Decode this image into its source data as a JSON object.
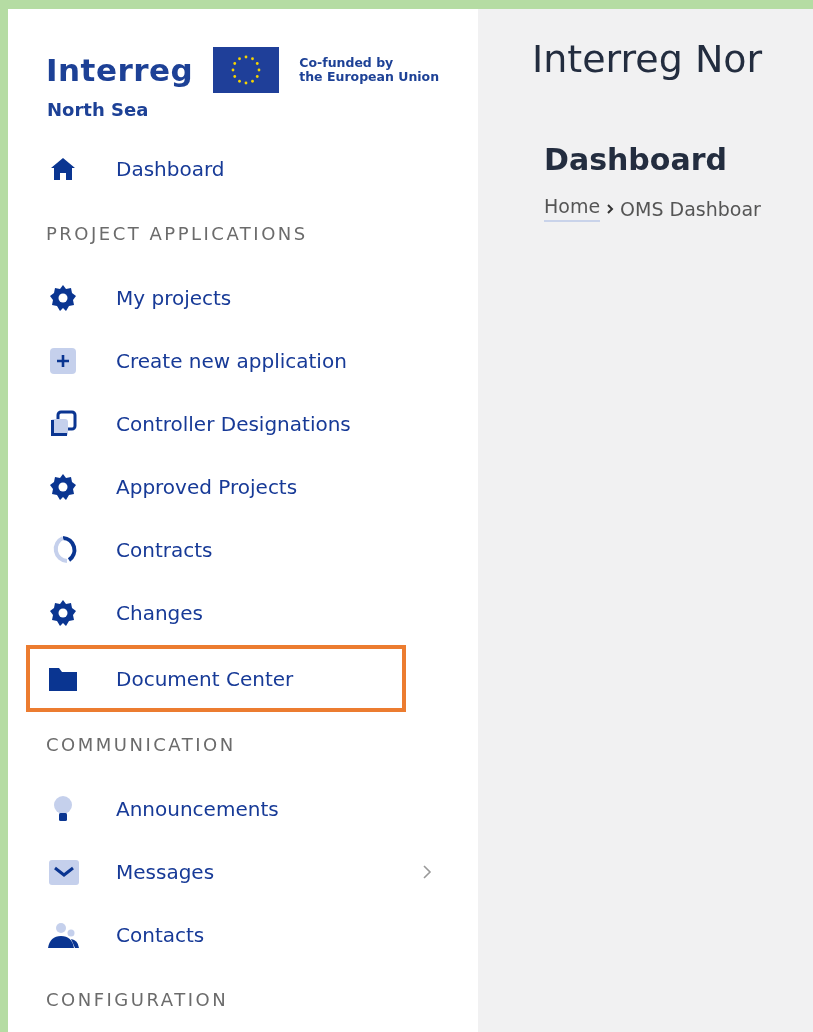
{
  "logo": {
    "wordmark": "Interreg",
    "eu_text": "Co-funded by\nthe European Union",
    "region": "North Sea"
  },
  "sidebar": {
    "sections": [
      {
        "items": [
          {
            "label": "Dashboard",
            "kind": "home",
            "has_submenu": false,
            "highlighted": false
          }
        ]
      },
      {
        "heading": "PROJECT APPLICATIONS",
        "items": [
          {
            "label": "My projects",
            "kind": "gear",
            "has_submenu": false,
            "highlighted": false
          },
          {
            "label": "Create new application",
            "kind": "plus",
            "has_submenu": false,
            "highlighted": false
          },
          {
            "label": "Controller Designations",
            "kind": "copy",
            "has_submenu": false,
            "highlighted": false
          },
          {
            "label": "Approved Projects",
            "kind": "gear",
            "has_submenu": false,
            "highlighted": false
          },
          {
            "label": "Contracts",
            "kind": "spinner",
            "has_submenu": false,
            "highlighted": false
          },
          {
            "label": "Changes",
            "kind": "gear",
            "has_submenu": false,
            "highlighted": false
          },
          {
            "label": "Document Center",
            "kind": "folder",
            "has_submenu": false,
            "highlighted": true
          }
        ]
      },
      {
        "heading": "COMMUNICATION",
        "items": [
          {
            "label": "Announcements",
            "kind": "bulb",
            "has_submenu": false,
            "highlighted": false
          },
          {
            "label": "Messages",
            "kind": "mail",
            "has_submenu": true,
            "highlighted": false
          },
          {
            "label": "Contacts",
            "kind": "people",
            "has_submenu": false,
            "highlighted": false
          }
        ]
      },
      {
        "heading": "CONFIGURATION"
      }
    ]
  },
  "main": {
    "title": "Interreg Nor",
    "page_title": "Dashboard",
    "breadcrumb": [
      {
        "label": "Home",
        "link": true
      },
      {
        "label": "OMS Dashboar",
        "link": false
      }
    ]
  }
}
